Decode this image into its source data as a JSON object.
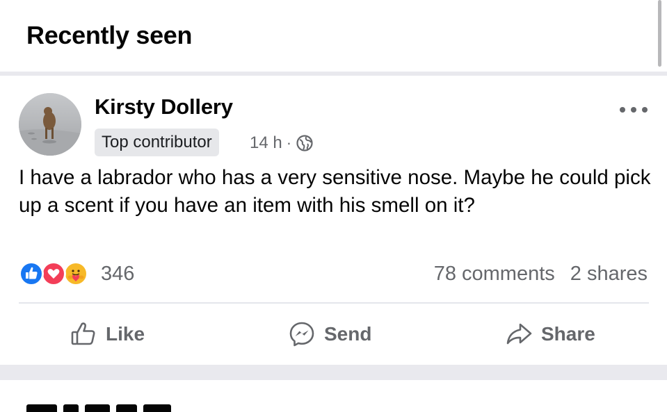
{
  "section": {
    "title": "Recently seen"
  },
  "post": {
    "author": {
      "name": "Kirsty Dollery",
      "badge": "Top contributor"
    },
    "meta": {
      "time": "14 h",
      "separator": "·",
      "privacy_icon": "globe-icon"
    },
    "more_icon": "more-dots-icon",
    "text": "I have a labrador who has a very sensitive nose. Maybe he could pick up a scent if you have an item with his smell on it?",
    "reactions": {
      "types": [
        "like",
        "love",
        "care"
      ],
      "count": "346"
    },
    "comments": "78 comments",
    "shares": "2 shares",
    "actions": {
      "like": "Like",
      "send": "Send",
      "share": "Share"
    }
  },
  "colors": {
    "like_blue": "#1877f2",
    "love_red": "#f33e58",
    "care_yellow": "#f7b928",
    "secondary_text": "#65676b",
    "separator": "#e9e9ee"
  }
}
